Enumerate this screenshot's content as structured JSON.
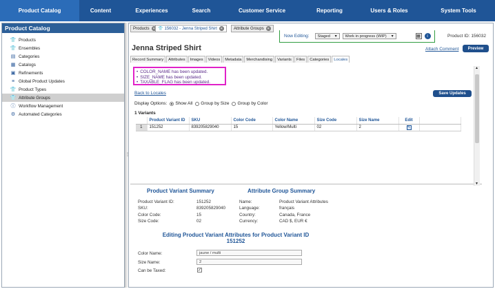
{
  "topnav": [
    {
      "label": "Product Catalog",
      "active": true
    },
    {
      "label": "Content"
    },
    {
      "label": "Experiences"
    },
    {
      "label": "Search"
    },
    {
      "label": "Customer Service"
    },
    {
      "label": "Reporting"
    },
    {
      "label": "Users & Roles"
    },
    {
      "label": "System Tools"
    }
  ],
  "sidebar": {
    "title": "Product Catalog",
    "items": [
      {
        "label": "Products",
        "icon": "shirt-icon"
      },
      {
        "label": "Ensembles",
        "icon": "ensemble-icon"
      },
      {
        "label": "Categories",
        "icon": "categories-icon"
      },
      {
        "label": "Catalogs",
        "icon": "catalog-icon"
      },
      {
        "label": "Refinements",
        "icon": "refinement-icon"
      },
      {
        "label": "Global Product Updates",
        "icon": "global-update-icon"
      },
      {
        "label": "Product Types",
        "icon": "product-type-icon"
      },
      {
        "label": "Attribute Groups",
        "icon": "attribute-group-icon",
        "selected": true
      },
      {
        "label": "Workflow Management",
        "icon": "info-icon"
      },
      {
        "label": "Automated Categories",
        "icon": "gear-icon"
      }
    ]
  },
  "doc_tabs": {
    "products": "Products",
    "product": "156032 - Jenna Striped Shirt",
    "attribute_groups": "Attribute Groups"
  },
  "editing": {
    "label": "Now Editing:",
    "status": "Staged",
    "workflow": "Work in progress (WIP)"
  },
  "product": {
    "title": "Jenna Striped Shirt",
    "id_text": "Product ID: 156032",
    "attach_comment": "Attach Comment",
    "preview": "Preview"
  },
  "subtabs": [
    "Record Summary",
    "Attributes",
    "Images",
    "Videos",
    "Metadata",
    "Merchandising",
    "Variants",
    "Files",
    "Categories",
    "Locales"
  ],
  "messages": [
    "COLOR_NAME has been updated.",
    "SIZE_NAME has been updated.",
    "TAXABLE_FLAG has been updated."
  ],
  "back_link": "Back to Locales",
  "save_updates": "Save Updates",
  "display_options": {
    "label": "Display Options:",
    "options": [
      "Show All",
      "Group by Size",
      "Group by Color"
    ]
  },
  "variants": {
    "count_label": "1 Variants",
    "headers": [
      "Product Variant ID",
      "SKU",
      "Color Code",
      "Color Name",
      "Size Code",
      "Size Name",
      "Edit"
    ],
    "rows": [
      {
        "num": "1",
        "id": "151252",
        "sku": "839205829040",
        "color_code": "15",
        "color_name": "Yellow/Multi",
        "size_code": "02",
        "size_name": "2"
      }
    ]
  },
  "variant_summary": {
    "title": "Product Variant Summary",
    "fields": [
      {
        "label": "Product Variant ID:",
        "value": "151252"
      },
      {
        "label": "SKU:",
        "value": "839205829040"
      },
      {
        "label": "Color Code:",
        "value": "15"
      },
      {
        "label": "Size Code:",
        "value": "02"
      }
    ]
  },
  "group_summary": {
    "title": "Attribute Group Summary",
    "fields": [
      {
        "label": "Name:",
        "value": "Product Variant Attributes"
      },
      {
        "label": "Language:",
        "value": "français"
      },
      {
        "label": "Country:",
        "value": "Canada, France"
      },
      {
        "label": "Currency:",
        "value": "CAD $, EUR €"
      }
    ]
  },
  "editing_section": {
    "title_line1": "Editing Product Variant Attributes for Product Variant ID",
    "title_line2": "151252",
    "color_name_label": "Color Name:",
    "color_name_value": "jaune / multi",
    "size_name_label": "Size Name:",
    "size_name_value": "2",
    "taxed_label": "Can be Taxed:",
    "taxed_checked": true
  }
}
